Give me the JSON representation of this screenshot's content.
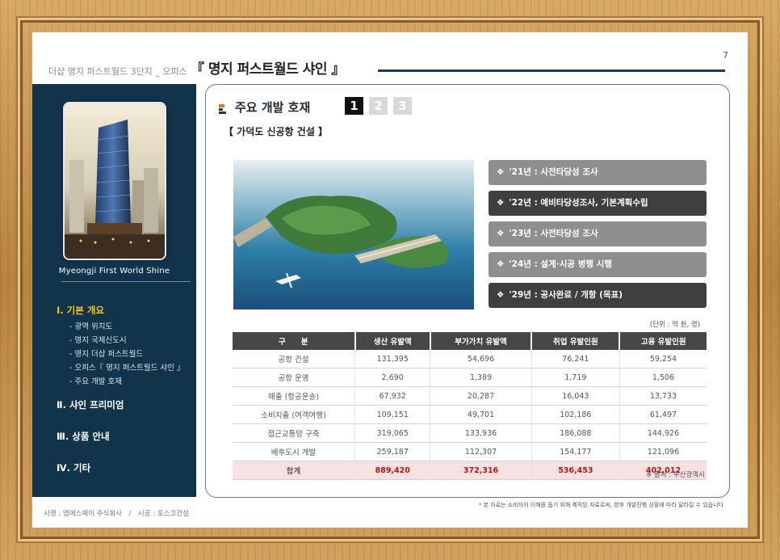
{
  "header": {
    "breadcrumb": "더샵 명지 퍼스트월드 3단지 _ 오피스",
    "title": "『 명지 퍼스트월드 샤인 』",
    "page_number": "7"
  },
  "sidebar": {
    "brand": "Myeongji First World Shine",
    "nav": [
      {
        "label": "Ⅰ. 기본 개요",
        "active": true,
        "subs": [
          "광역 위치도",
          "명지 국제신도시",
          "명지 더샵 퍼스트월드",
          "오피스『 명지 퍼스트월드 샤인 』",
          "주요 개발 호재"
        ]
      },
      {
        "label": "Ⅱ. 샤인 프리미엄",
        "active": false
      },
      {
        "label": "Ⅲ. 상품 안내",
        "active": false
      },
      {
        "label": "Ⅳ. 기타",
        "active": false
      }
    ]
  },
  "content": {
    "section_title": "주요 개발 호재",
    "page_tabs": [
      "1",
      "2",
      "3"
    ],
    "active_tab": 0,
    "sub_title": "【 가덕도 신공항 건설 】",
    "timeline": [
      {
        "text": "'21년 : 사전타당성 조사",
        "style": "light"
      },
      {
        "text": "'22년 : 예비타당성조사, 기본계획수립",
        "style": "dark"
      },
      {
        "text": "'23년 : 사전타당성 조사",
        "style": "light"
      },
      {
        "text": "'24년 : 설계·시공 병행 시행",
        "style": "light"
      },
      {
        "text": "'29년 : 공사완료 / 개항 (목표)",
        "style": "dark"
      }
    ],
    "unit": "(단위 : 억 원, 명)",
    "table": {
      "headers": [
        "구　　분",
        "생산 유발액",
        "부가가치 유발액",
        "취업 유발인원",
        "고용 유발인원"
      ],
      "rows": [
        [
          "공항 건설",
          "131,395",
          "54,696",
          "76,241",
          "59,254"
        ],
        [
          "공항 운영",
          "2,690",
          "1,389",
          "1,719",
          "1,506"
        ],
        [
          "매출 (항공운송)",
          "67,932",
          "20,287",
          "16,043",
          "13,733"
        ],
        [
          "소비지출 (여객여행)",
          "109,151",
          "49,701",
          "102,186",
          "61,497"
        ],
        [
          "접근교통망 구축",
          "319,065",
          "133,936",
          "186,088",
          "144,926"
        ],
        [
          "배후도시 개발",
          "259,187",
          "112,307",
          "154,177",
          "121,096"
        ]
      ],
      "total": [
        "합계",
        "889,420",
        "372,316",
        "536,453",
        "402,012"
      ]
    },
    "source": "※ 출처 : 부산광역시"
  },
  "footer": {
    "left": "시행 : 엠에스예이 주식회사　/　시공 : 포스코건설",
    "disclaimer": "* 본 자료는 소비자의 이해를 돕기 위해 제작된 자료로써, 향후 개발진행 상황에 따라 달라질 수 있습니다"
  },
  "colors": {
    "sidebar_bg": "#12344a",
    "active_nav": "#f5c51c",
    "total_row_bg": "#f6e0e0",
    "total_value": "#b01818"
  }
}
